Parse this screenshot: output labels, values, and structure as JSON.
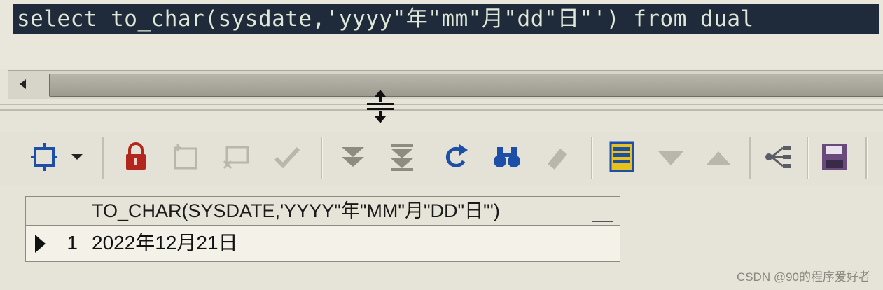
{
  "editor": {
    "sql_text": "select to_char(sysdate,'yyyy\"年\"mm\"月\"dd\"日\"') from dual"
  },
  "toolbar": {
    "buttons": [
      {
        "name": "select-mode-icon",
        "label": "Select"
      },
      {
        "name": "lock-icon",
        "label": "Lock"
      },
      {
        "name": "insert-record-icon",
        "label": "Insert record"
      },
      {
        "name": "delete-record-icon",
        "label": "Delete record"
      },
      {
        "name": "post-changes-icon",
        "label": "Post changes"
      },
      {
        "name": "fetch-next-icon",
        "label": "Fetch next"
      },
      {
        "name": "fetch-last-icon",
        "label": "Fetch last"
      },
      {
        "name": "refresh-icon",
        "label": "Refresh"
      },
      {
        "name": "find-icon",
        "label": "Find"
      },
      {
        "name": "clear-icon",
        "label": "Clear"
      },
      {
        "name": "export-icon",
        "label": "Export"
      },
      {
        "name": "next-icon",
        "label": "Next"
      },
      {
        "name": "previous-icon",
        "label": "Previous"
      },
      {
        "name": "connections-icon",
        "label": "Connections"
      },
      {
        "name": "save-icon",
        "label": "Save"
      }
    ]
  },
  "grid": {
    "columns": [
      "TO_CHAR(SYSDATE,'YYYY\"年\"MM\"月\"DD\"日\"')"
    ],
    "rows": [
      {
        "num": "1",
        "cells": [
          "2022年12月21日"
        ]
      }
    ]
  },
  "watermark": "CSDN @90的程序爱好者",
  "colors": {
    "editor_selection": "#1f2a3a",
    "lock_red": "#b3261e",
    "action_blue": "#1e4fa8",
    "export_yellow": "#e6c21a",
    "save_purple": "#6a4a7a"
  }
}
